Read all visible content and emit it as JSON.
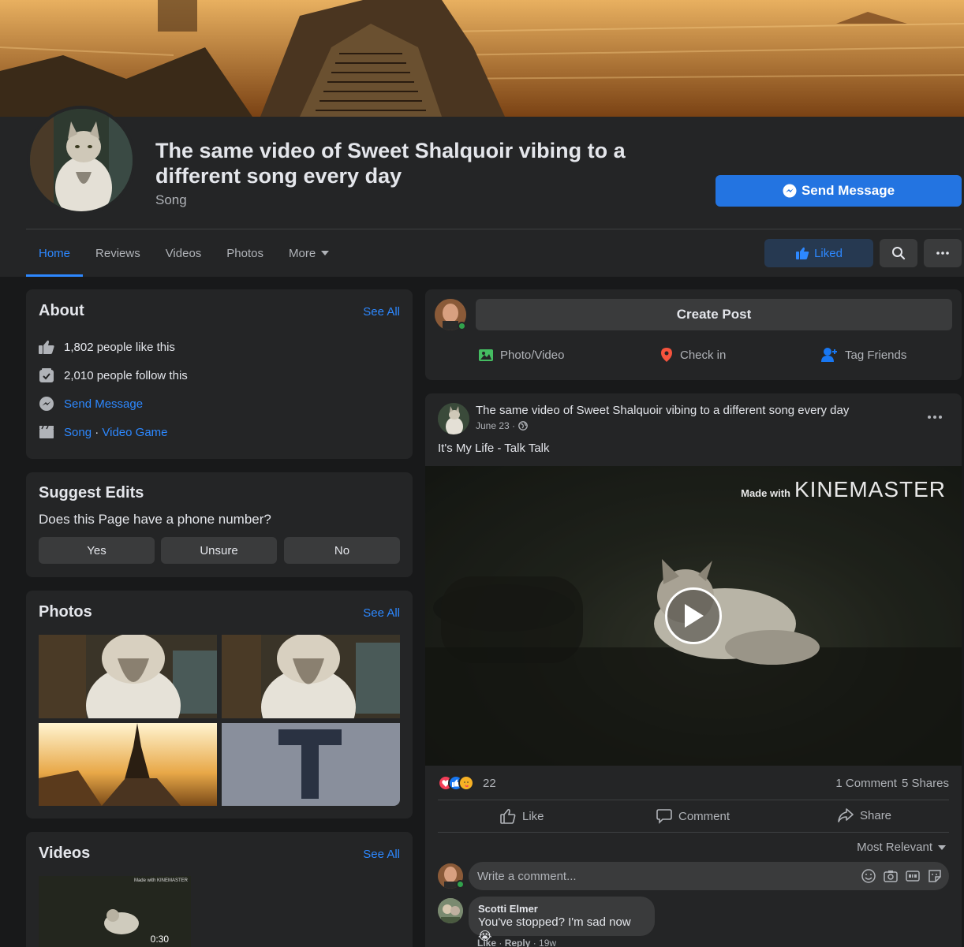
{
  "page": {
    "title": "The same video of Sweet Shalquoir vibing to a different song every day",
    "category": "Song",
    "send_message_label": "Send Message"
  },
  "tabs": [
    {
      "label": "Home"
    },
    {
      "label": "Reviews"
    },
    {
      "label": "Videos"
    },
    {
      "label": "Photos"
    },
    {
      "label": "More"
    }
  ],
  "toolbar": {
    "liked_label": "Liked"
  },
  "about": {
    "title": "About",
    "see_all": "See All",
    "likes": "1,802 people like this",
    "follows": "2,010 people follow this",
    "send_message": "Send Message",
    "cat_song": "Song",
    "cat_sep": " · ",
    "cat_game": "Video Game"
  },
  "suggest": {
    "title": "Suggest Edits",
    "question": "Does this Page have a phone number?",
    "yes": "Yes",
    "unsure": "Unsure",
    "no": "No"
  },
  "photos": {
    "title": "Photos",
    "see_all": "See All",
    "letter_tile": "T"
  },
  "videos": {
    "title": "Videos",
    "see_all": "See All",
    "duration": "0:30",
    "thumb_watermark": "Made with KINEMASTER"
  },
  "composer": {
    "create_post": "Create Post",
    "photo_video": "Photo/Video",
    "check_in": "Check in",
    "tag_friends": "Tag Friends"
  },
  "post": {
    "author": "The same video of Sweet Shalquoir vibing to a different song every day",
    "date": "June 23 ·",
    "text": "It's My Life - Talk Talk",
    "watermark_small": "Made with",
    "watermark_big": "KINEMASTER",
    "reaction_count": "22",
    "comments": "1 Comment",
    "shares": "5 Shares",
    "like": "Like",
    "comment": "Comment",
    "share": "Share",
    "sort": "Most Relevant",
    "comment_placeholder": "Write a comment..."
  },
  "comment": {
    "name": "Scotti Elmer",
    "text": "You've stopped? I'm sad now 😭",
    "like": "Like",
    "reply": "Reply",
    "sep": " · ",
    "age": "19w"
  },
  "colors": {
    "accent": "#2d88ff",
    "primary_button": "#2374e1",
    "card": "#242526",
    "background": "#18191a"
  }
}
